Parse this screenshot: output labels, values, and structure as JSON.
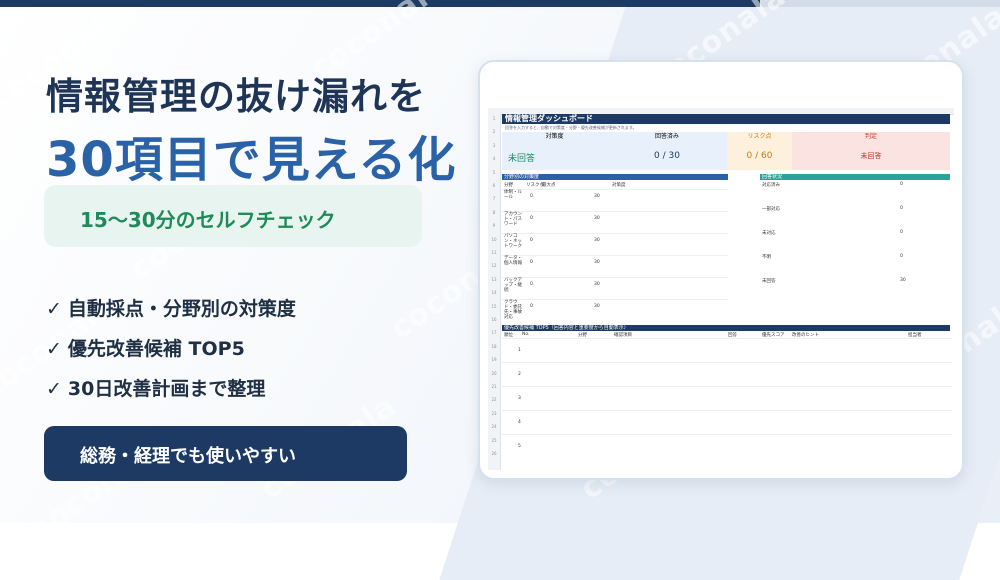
{
  "headline": {
    "line1": "情報管理の抜け漏れを",
    "line2": "30項目で見える化"
  },
  "badge": {
    "label": "15〜30分のセルフチェック"
  },
  "features": [
    {
      "mark": "✓",
      "text": "自動採点・分野別の対策度"
    },
    {
      "mark": "✓",
      "text": "優先改善候補 TOP5"
    },
    {
      "mark": "✓",
      "text": "30日改善計画まで整理"
    }
  ],
  "cta": {
    "label": "総務・経理でも使いやすい"
  },
  "watermark": "coconala",
  "spreadsheet": {
    "title": "情報管理ダッシュボード",
    "subtitle": "回答を入力すると、自動で対策度・分野・優先改善候補が更新されます。",
    "kpis": [
      {
        "label": "対策度",
        "value": "未回答"
      },
      {
        "label": "回答済み",
        "value": "0 / 30"
      },
      {
        "label": "リスク点",
        "value": "0 / 60"
      },
      {
        "label": "判定",
        "value": "未回答"
      }
    ],
    "section_left": "分野別の対策度",
    "section_right": "回答状況",
    "left_columns": [
      "分野",
      "リスク点",
      "最大点",
      "対策度"
    ],
    "left_rows": [
      {
        "name": "体制・ルール",
        "risk": "0",
        "max": "30"
      },
      {
        "name": "アカウント・パスワード",
        "risk": "0",
        "max": "30"
      },
      {
        "name": "パソコン・ネットワーク",
        "risk": "0",
        "max": "30"
      },
      {
        "name": "データ・個人情報",
        "risk": "0",
        "max": "30"
      },
      {
        "name": "バックアップ・継続",
        "risk": "0",
        "max": "30"
      },
      {
        "name": "クラウド・委託先・事故対応",
        "risk": "0",
        "max": "30"
      }
    ],
    "right_rows": [
      {
        "label": "対応済み",
        "value": "0"
      },
      {
        "label": "一部対応",
        "value": "0"
      },
      {
        "label": "未対応",
        "value": "0"
      },
      {
        "label": "不明",
        "value": "0"
      },
      {
        "label": "未回答",
        "value": "30"
      }
    ],
    "top5_title": "優先改善候補 TOP5（回答内容と重要度から自動表示）",
    "top5_columns": [
      "順位",
      "No.",
      "分野",
      "確認項目",
      "回答",
      "優先スコア",
      "改善のヒント",
      "担当者"
    ],
    "top5_ranks": [
      "1",
      "2",
      "3",
      "4",
      "5"
    ],
    "row_numbers": [
      "1",
      "2",
      "3",
      "4",
      "5",
      "6",
      "7",
      "8",
      "9",
      "10",
      "11",
      "12",
      "13",
      "14",
      "15",
      "16",
      "17",
      "18",
      "19",
      "20",
      "21",
      "22",
      "23",
      "24",
      "25",
      "26"
    ]
  },
  "colors": {
    "navy": "#1c3a63",
    "blue": "#2a62a8",
    "green": "#1f8a5a",
    "kpi_blue_bg": "#e8f1fb",
    "kpi_orange_bg": "#fdf0dc",
    "kpi_red_bg": "#fbe3e1",
    "kpi_green_text": "#1f8a5a",
    "kpi_orange_text": "#c77a13",
    "kpi_red_text": "#c0392b"
  }
}
